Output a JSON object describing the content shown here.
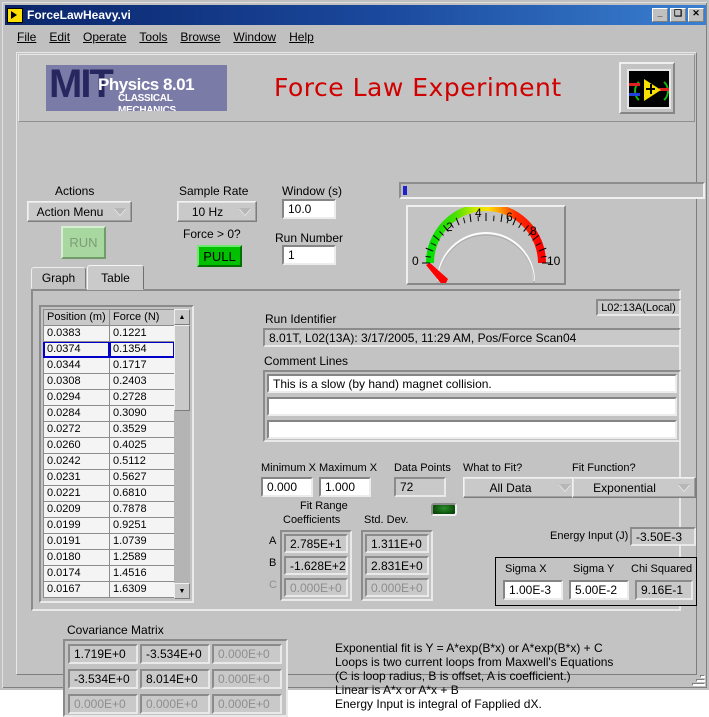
{
  "window": {
    "title": "ForceLawHeavy.vi",
    "icon": "labview-vi-icon",
    "minimize_label": "_",
    "maximize_label": "□",
    "close_label": "✕"
  },
  "menu": {
    "items": [
      "File",
      "Edit",
      "Operate",
      "Tools",
      "Browse",
      "Window",
      "Help"
    ]
  },
  "banner": {
    "logo_letters": "MIT",
    "logo_line1": "Physics 8.01",
    "logo_line2": "CLASSICAL MECHANICS",
    "title": "Force Law Experiment",
    "logo_bg_color": "#7b7ba8",
    "logo_text_color": "#26275e",
    "title_color": "#d00000",
    "right_icon": "labview-logo-icon"
  },
  "controls": {
    "actions_label": "Actions",
    "actions_value": "Action Menu",
    "run_label": "RUN",
    "sample_rate_label": "Sample Rate",
    "sample_rate_value": "10 Hz",
    "force_positive_label": "Force > 0?",
    "force_positive_value": "PULL",
    "window_label": "Window (s)",
    "window_value": "10.0",
    "run_number_label": "Run Number",
    "run_number_value": "1"
  },
  "gauge": {
    "min": 0,
    "max": 10,
    "value": 0,
    "ticks": [
      "0",
      "2",
      "4",
      "6",
      "8",
      "10"
    ],
    "needle_color": "#ff0000"
  },
  "tabs": {
    "items": [
      {
        "label": "Graph",
        "active": false
      },
      {
        "label": "Table",
        "active": true
      }
    ]
  },
  "table": {
    "columns": [
      "Position (m)",
      "Force (N)"
    ],
    "selected_row": 1,
    "rows": [
      [
        "0.0383",
        "0.1221"
      ],
      [
        "0.0374",
        "0.1354"
      ],
      [
        "0.0344",
        "0.1717"
      ],
      [
        "0.0308",
        "0.2403"
      ],
      [
        "0.0294",
        "0.2728"
      ],
      [
        "0.0284",
        "0.3090"
      ],
      [
        "0.0272",
        "0.3529"
      ],
      [
        "0.0260",
        "0.4025"
      ],
      [
        "0.0242",
        "0.5112"
      ],
      [
        "0.0231",
        "0.5627"
      ],
      [
        "0.0221",
        "0.6810"
      ],
      [
        "0.0209",
        "0.7878"
      ],
      [
        "0.0199",
        "0.9251"
      ],
      [
        "0.0191",
        "1.0739"
      ],
      [
        "0.0180",
        "1.2589"
      ],
      [
        "0.0174",
        "1.4516"
      ],
      [
        "0.0167",
        "1.6309"
      ]
    ],
    "scroll_up_icon": "triangle-up-icon",
    "scroll_down_icon": "triangle-down-icon"
  },
  "run_info": {
    "station_badge": "L02:13A(Local)",
    "run_identifier_label": "Run Identifier",
    "run_identifier_value": "8.01T, L02(13A): 3/17/2005, 11:29 AM, Pos/Force Scan04",
    "comment_label": "Comment Lines",
    "comment_lines": [
      "This is a slow (by hand) magnet collision.",
      "",
      ""
    ]
  },
  "fit": {
    "min_x_label": "Minimum X",
    "min_x_value": "0.000",
    "max_x_label": "Maximum X",
    "max_x_value": "1.000",
    "fit_range_label": "Fit Range",
    "data_points_label": "Data Points",
    "data_points_value": "72",
    "what_to_fit_label": "What to Fit?",
    "what_to_fit_value": "All Data",
    "fit_function_label": "Fit Function?",
    "fit_function_value": "Exponential",
    "led_name": "data-points-led"
  },
  "coefficients": {
    "coeff_header": "Coefficients",
    "stddev_header": "Std. Dev.",
    "rows": [
      {
        "name": "A",
        "coeff": "2.785E+1",
        "stddev": "1.311E+0",
        "dim": false
      },
      {
        "name": "B",
        "coeff": "-1.628E+2",
        "stddev": "2.831E+0",
        "dim": false
      },
      {
        "name": "C",
        "coeff": "0.000E+0",
        "stddev": "0.000E+0",
        "dim": true
      }
    ]
  },
  "energy": {
    "label": "Energy Input (J)",
    "value": "-3.50E-3"
  },
  "stats": {
    "sigma_x_label": "Sigma X",
    "sigma_x_value": "1.00E-3",
    "sigma_y_label": "Sigma Y",
    "sigma_y_value": "5.00E-2",
    "chi_squared_label": "Chi Squared",
    "chi_squared_value": "9.16E-1"
  },
  "covariance": {
    "label": "Covariance Matrix",
    "cells": [
      [
        {
          "v": "1.719E+0",
          "dim": false
        },
        {
          "v": "-3.534E+0",
          "dim": false
        },
        {
          "v": "0.000E+0",
          "dim": true
        }
      ],
      [
        {
          "v": "-3.534E+0",
          "dim": false
        },
        {
          "v": "8.014E+0",
          "dim": false
        },
        {
          "v": "0.000E+0",
          "dim": true
        }
      ],
      [
        {
          "v": "0.000E+0",
          "dim": true
        },
        {
          "v": "0.000E+0",
          "dim": true
        },
        {
          "v": "0.000E+0",
          "dim": true
        }
      ]
    ]
  },
  "help": {
    "lines": [
      "Exponential fit is Y = A*exp(B*x) or A*exp(B*x) + C",
      "Loops is two current loops from Maxwell's Equations",
      "(C is loop radius, B is offset, A is coefficient.)",
      "Linear is A*x or A*x + B",
      "Energy Input is integral of Fapplied dX."
    ]
  }
}
